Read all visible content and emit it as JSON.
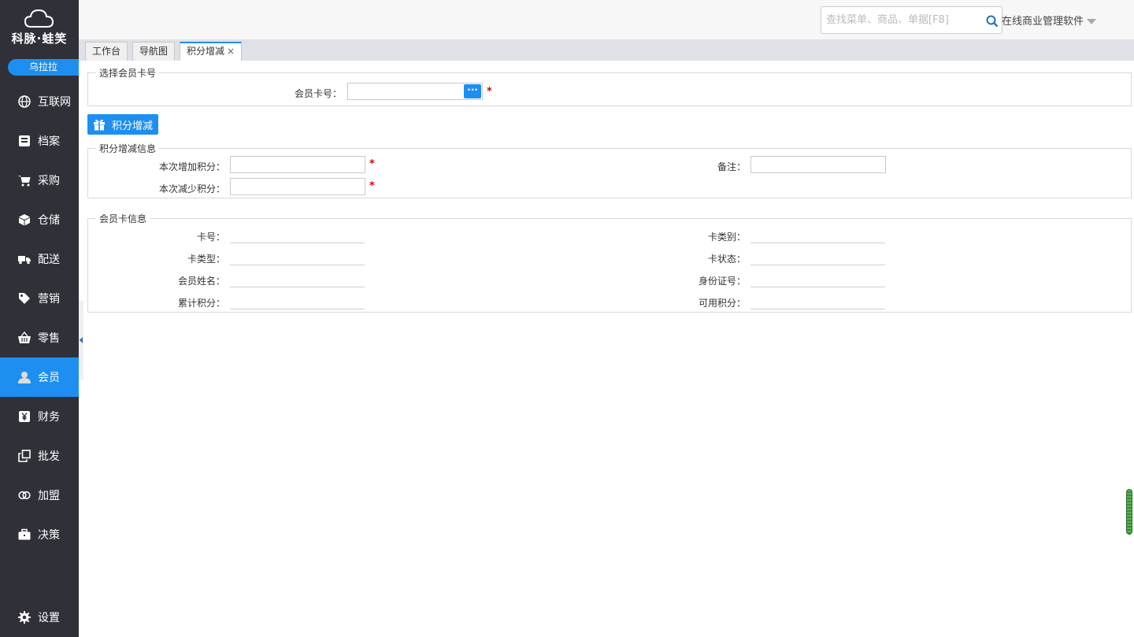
{
  "brand": {
    "name": "科脉·蛙笑",
    "user": "乌拉拉"
  },
  "nav": {
    "items": [
      {
        "label": "互联网",
        "icon": "globe-icon"
      },
      {
        "label": "档案",
        "icon": "file-icon"
      },
      {
        "label": "采购",
        "icon": "cart-icon"
      },
      {
        "label": "仓储",
        "icon": "box-icon"
      },
      {
        "label": "配送",
        "icon": "truck-icon"
      },
      {
        "label": "营销",
        "icon": "tag-icon"
      },
      {
        "label": "零售",
        "icon": "basket-icon"
      },
      {
        "label": "会员",
        "icon": "user-icon",
        "active": true
      },
      {
        "label": "财务",
        "icon": "yen-icon"
      },
      {
        "label": "批发",
        "icon": "copy-icon"
      },
      {
        "label": "加盟",
        "icon": "rings-icon"
      },
      {
        "label": "决策",
        "icon": "briefcase-icon"
      }
    ],
    "settings": "设置"
  },
  "header": {
    "search_placeholder": "查找菜单、商品、单据[F8]",
    "company": "在线商业管理软件"
  },
  "tabs": [
    {
      "label": "工作台"
    },
    {
      "label": "导航图"
    },
    {
      "label": "积分增减",
      "active": true,
      "close": "×"
    }
  ],
  "select_card": {
    "legend": "选择会员卡号",
    "card_label": "会员卡号：",
    "card_value": "",
    "pick_label": "···",
    "required": "*"
  },
  "action": {
    "label": "积分增减"
  },
  "points_info": {
    "legend": "积分增减信息",
    "add_label": "本次增加积分：",
    "add_value": "",
    "reduce_label": "本次减少积分：",
    "reduce_value": "",
    "remark_label": "备注：",
    "remark_value": "",
    "required": "*"
  },
  "card_info": {
    "legend": "会员卡信息",
    "card_no": "卡号：",
    "card_type": "卡类型：",
    "member_name": "会员姓名：",
    "total_points": "累计积分：",
    "card_category": "卡类别：",
    "card_status": "卡状态：",
    "id_number": "身份证号：",
    "available_points": "可用积分："
  },
  "colors": {
    "sidebar_bg": "#2f3038",
    "accent": "#1e8ff0",
    "required": "#dd0000"
  }
}
